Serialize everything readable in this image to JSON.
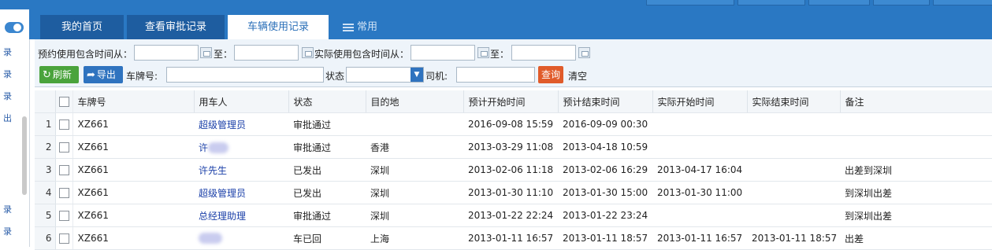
{
  "tabs": [
    {
      "label": "我的首页",
      "active": false
    },
    {
      "label": "查看审批记录",
      "active": false
    },
    {
      "label": "车辆使用记录",
      "active": true
    }
  ],
  "tab_more": {
    "label": "常用"
  },
  "sidebar": {
    "items": [
      "录",
      "录",
      "录",
      "出",
      "录",
      "录"
    ]
  },
  "filters": {
    "booking_from_label": "预约使用包含时间从：",
    "to_label": "至：",
    "actual_from_label": "实际使用包含时间从：",
    "plate_label": "车牌号:",
    "status_label": "状态",
    "driver_label": "司机:",
    "refresh": "刷新",
    "export": "导出",
    "query": "查询",
    "clear": "清空"
  },
  "table": {
    "columns": [
      "车牌号",
      "用车人",
      "状态",
      "目的地",
      "预计开始时间",
      "预计结束时间",
      "实际开始时间",
      "实际结束时间",
      "备注"
    ],
    "rows": [
      {
        "n": "1",
        "plate": "XZ661",
        "user": "超级管理员",
        "user_link": true,
        "user_blur": false,
        "status": "审批通过",
        "dest": "",
        "ps": "2016-09-08 15:59",
        "pe": "2016-09-09 00:30",
        "as": "",
        "ae": "",
        "note": ""
      },
      {
        "n": "2",
        "plate": "XZ661",
        "user": "许",
        "user_link": true,
        "user_blur": true,
        "status": "审批通过",
        "dest": "香港",
        "ps": "2013-03-29 11:08",
        "pe": "2013-04-18 10:59",
        "as": "",
        "ae": "",
        "note": ""
      },
      {
        "n": "3",
        "plate": "XZ661",
        "user": "许先生",
        "user_link": true,
        "user_blur": false,
        "status": "已发出",
        "dest": "深圳",
        "ps": "2013-02-06 11:18",
        "pe": "2013-02-06 16:29",
        "as": "2013-04-17 16:04",
        "ae": "",
        "note": "出差到深圳"
      },
      {
        "n": "4",
        "plate": "XZ661",
        "user": "超级管理员",
        "user_link": true,
        "user_blur": false,
        "status": "已发出",
        "dest": "深圳",
        "ps": "2013-01-30 11:10",
        "pe": "2013-01-30 15:00",
        "as": "2013-01-30 11:00",
        "ae": "",
        "note": "到深圳出差"
      },
      {
        "n": "5",
        "plate": "XZ661",
        "user": "总经理助理",
        "user_link": true,
        "user_blur": false,
        "status": "审批通过",
        "dest": "深圳",
        "ps": "2013-01-22 22:24",
        "pe": "2013-01-22 23:24",
        "as": "",
        "ae": "",
        "note": "到深圳出差"
      },
      {
        "n": "6",
        "plate": "XZ661",
        "user": "",
        "user_link": false,
        "user_blur": true,
        "status": "车已回",
        "dest": "上海",
        "ps": "2013-01-11 16:57",
        "pe": "2013-01-11 18:57",
        "as": "2013-01-11 16:57",
        "ae": "2013-01-11 18:57",
        "note": "出差"
      }
    ]
  },
  "colors": {
    "accent": "#2a78c3",
    "refresh": "#4aa33c",
    "export": "#2f73bf",
    "query": "#e05b2a",
    "link": "#1a3fa8"
  }
}
